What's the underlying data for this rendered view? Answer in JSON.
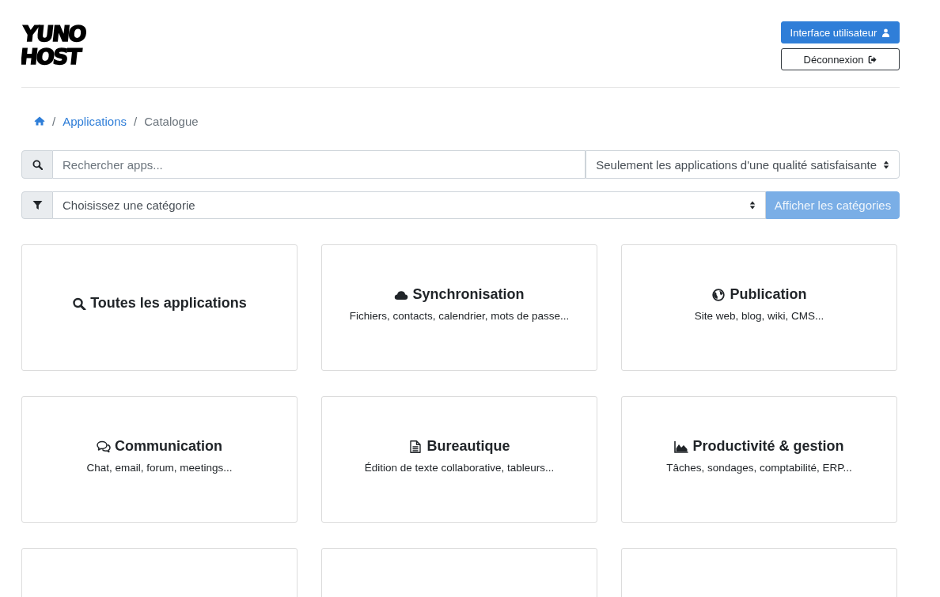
{
  "logo": {
    "lines": [
      "YUNO",
      "HOST"
    ]
  },
  "header_buttons": [
    {
      "label": "Interface utilisateur",
      "kind": "user",
      "disabled": false
    },
    {
      "label": "Déconnexion",
      "kind": "logout",
      "disabled": false
    }
  ],
  "breadcrumb": [
    {
      "kind": "home",
      "active": false
    },
    {
      "kind": "link",
      "separator": "/",
      "label": "Applications",
      "active": false
    },
    {
      "kind": "link",
      "separator": "/",
      "label": "Catalogue",
      "active": true
    }
  ],
  "search": {
    "placeholder": "Rechercher apps...",
    "quality_filter": "Seulement les applications d'une qualité satisfaisante"
  },
  "category_filter": {
    "value": "Choisissez une catégorie",
    "button": {
      "label": "Afficher les catégories",
      "disabled": true
    }
  },
  "cards": [
    {
      "title": "Toutes les applications"
    },
    {
      "title": "Synchronisation",
      "description": "Fichiers, contacts, calendrier, mots de passe..."
    },
    {
      "title": "Publication",
      "description": "Site web, blog, wiki, CMS..."
    },
    {
      "title": "Communication",
      "description": "Chat, email, forum, meetings..."
    },
    {
      "title": "Bureautique",
      "description": "Édition de texte collaborative, tableurs..."
    },
    {
      "title": "Productivité & gestion",
      "description": "Tâches, sondages, comptabilité, ERP..."
    },
    {
      "kind": "cut"
    },
    {
      "kind": "cut"
    },
    {
      "kind": "cut"
    }
  ]
}
